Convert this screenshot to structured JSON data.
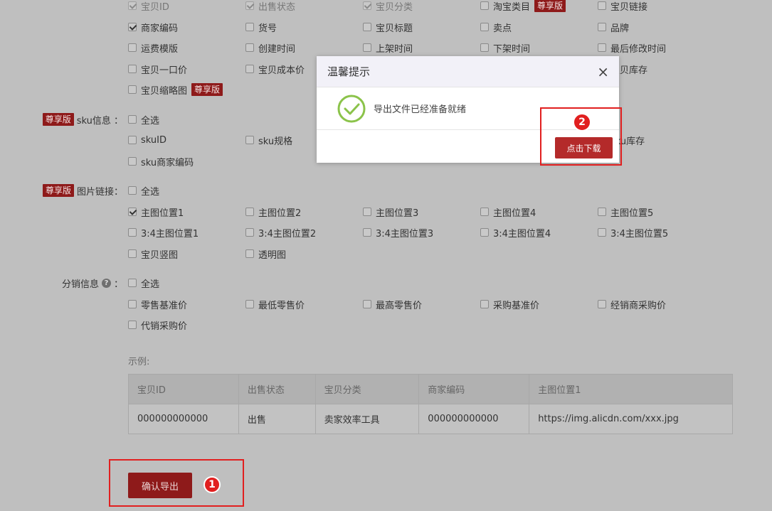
{
  "base_fields": {
    "rows": [
      [
        {
          "label": "宝贝ID",
          "checked": true,
          "disabled": true
        },
        {
          "label": "出售状态",
          "checked": true,
          "disabled": true
        },
        {
          "label": "宝贝分类",
          "checked": true,
          "disabled": true
        },
        {
          "label": "淘宝类目",
          "checked": false,
          "badge": "尊享版"
        },
        {
          "label": "宝贝链接",
          "checked": false
        }
      ],
      [
        {
          "label": "商家编码",
          "checked": true
        },
        {
          "label": "货号",
          "checked": false
        },
        {
          "label": "宝贝标题",
          "checked": false
        },
        {
          "label": "卖点",
          "checked": false
        },
        {
          "label": "品牌",
          "checked": false
        }
      ],
      [
        {
          "label": "运费模版",
          "checked": false
        },
        {
          "label": "创建时间",
          "checked": false
        },
        {
          "label": "上架时间",
          "checked": false
        },
        {
          "label": "下架时间",
          "checked": false
        },
        {
          "label": "最后修改时间",
          "checked": false
        }
      ],
      [
        {
          "label": "宝贝一口价",
          "checked": false
        },
        {
          "label": "宝贝成本价",
          "checked": false
        },
        {
          "label": "宝贝库存",
          "checked": false
        }
      ],
      [
        {
          "label": "宝贝缩略图",
          "checked": false,
          "badge": "尊享版"
        }
      ]
    ]
  },
  "sku_group": {
    "badge": "尊享版",
    "label": "sku信息 ：",
    "rows": [
      [
        {
          "label": "全选",
          "checked": false
        }
      ],
      [
        {
          "label": "skuID",
          "checked": false
        },
        {
          "label": "sku规格",
          "checked": false
        },
        {
          "label": "sku库存",
          "checked": false
        }
      ],
      [
        {
          "label": "sku商家编码",
          "checked": false
        }
      ]
    ]
  },
  "image_group": {
    "badge": "尊享版",
    "label": "图片链接：",
    "rows": [
      [
        {
          "label": "全选",
          "checked": false
        }
      ],
      [
        {
          "label": "主图位置1",
          "checked": true
        },
        {
          "label": "主图位置2",
          "checked": false
        },
        {
          "label": "主图位置3",
          "checked": false
        },
        {
          "label": "主图位置4",
          "checked": false
        },
        {
          "label": "主图位置5",
          "checked": false
        }
      ],
      [
        {
          "label": "3:4主图位置1",
          "checked": false
        },
        {
          "label": "3:4主图位置2",
          "checked": false
        },
        {
          "label": "3:4主图位置3",
          "checked": false
        },
        {
          "label": "3:4主图位置4",
          "checked": false
        },
        {
          "label": "3:4主图位置5",
          "checked": false
        }
      ],
      [
        {
          "label": "宝贝竖图",
          "checked": false
        },
        {
          "label": "透明图",
          "checked": false
        }
      ]
    ]
  },
  "distribution_group": {
    "label": "分销信息",
    "rows": [
      [
        {
          "label": "全选",
          "checked": false
        }
      ],
      [
        {
          "label": "零售基准价",
          "checked": false
        },
        {
          "label": "最低零售价",
          "checked": false
        },
        {
          "label": "最高零售价",
          "checked": false
        },
        {
          "label": "采购基准价",
          "checked": false
        },
        {
          "label": "经销商采购价",
          "checked": false
        }
      ],
      [
        {
          "label": "代销采购价",
          "checked": false
        }
      ]
    ]
  },
  "example": {
    "title": "示例:",
    "headers": [
      "宝贝ID",
      "出售状态",
      "宝贝分类",
      "商家编码",
      "主图位置1"
    ],
    "row": [
      "000000000000",
      "出售",
      "卖家效率工具",
      "000000000000",
      "https://img.alicdn.com/xxx.jpg"
    ]
  },
  "confirm_button": "确认导出",
  "steps": {
    "one": "1",
    "two": "2"
  },
  "dialog": {
    "title": "温馨提示",
    "message": "导出文件已经准备就绪",
    "download_label": "点击下载",
    "close_glyph": "×"
  },
  "colors": {
    "accent": "#8e1a1a",
    "highlight": "#e11f1f",
    "success": "#8bc34a"
  }
}
